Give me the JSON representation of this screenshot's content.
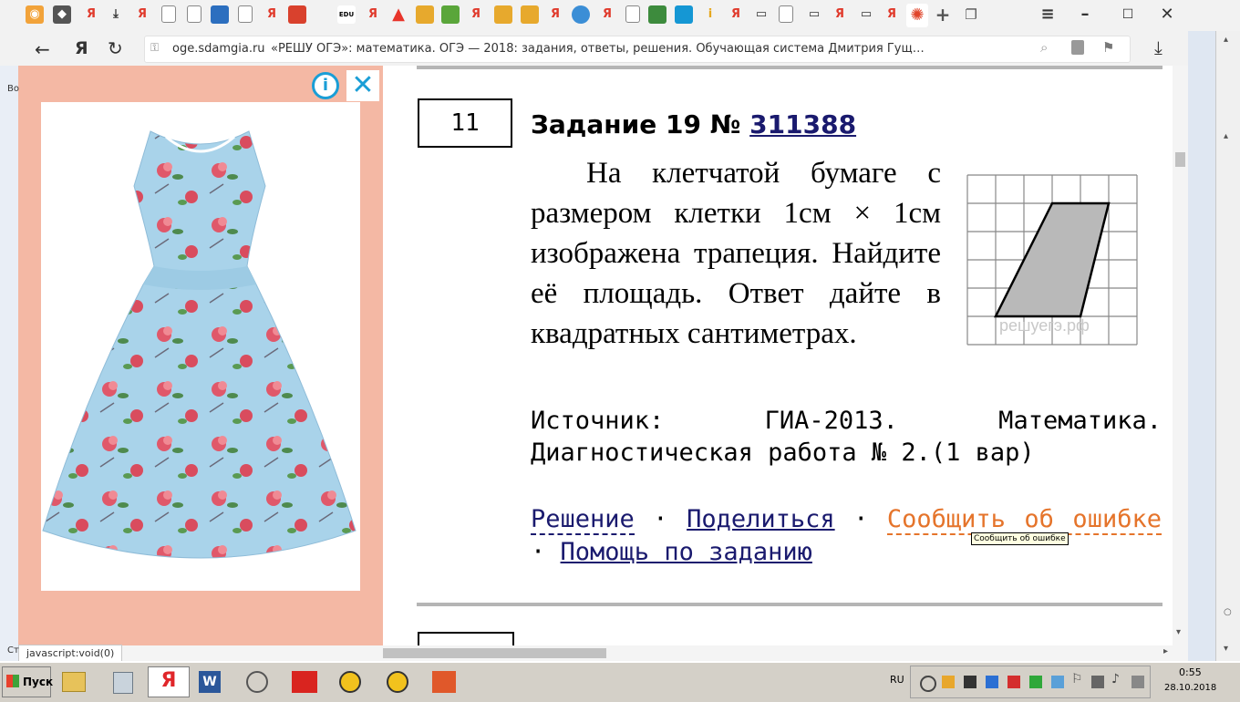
{
  "browser": {
    "url_domain": "oge.sdamgia.ru",
    "page_title": "«РЕШУ ОГЭ»: математика. ОГЭ — 2018: задания, ответы, решения. Обучающая система Дмитрия Гущ…",
    "yandex_logo": "Я",
    "tab_badge": "EDU",
    "status_url": "javascript:void(0)"
  },
  "ad": {
    "info_icon": "info-icon",
    "close_icon": "close-icon",
    "image": "floral-dress-image"
  },
  "task": {
    "number": "11",
    "title_prefix": "Задание 19 № ",
    "title_id": "311388",
    "body": "На клетчатой бумаге с размером клетки 1см × 1см изображена трапеция. Найдите её площадь. Ответ дайте в квадратных сантиметрах.",
    "figure_watermark": "решуегэ.рф",
    "source": "Источник: ГИА-2013. Математика. Диагностическая работа № 2.(1 вар)",
    "links": {
      "solution": "Решение",
      "share": "Поделиться",
      "report": "Сообщить об ошибке",
      "help": "Помощь по заданию",
      "separator": "·"
    },
    "tooltip": "Сообщить об ошибке"
  },
  "taskbar": {
    "start_label": "Пуск",
    "language": "RU",
    "time": "0:55",
    "date": "28.10.2018"
  },
  "background_app": {
    "side_letter": "Во",
    "side_letter2": "Ст"
  }
}
